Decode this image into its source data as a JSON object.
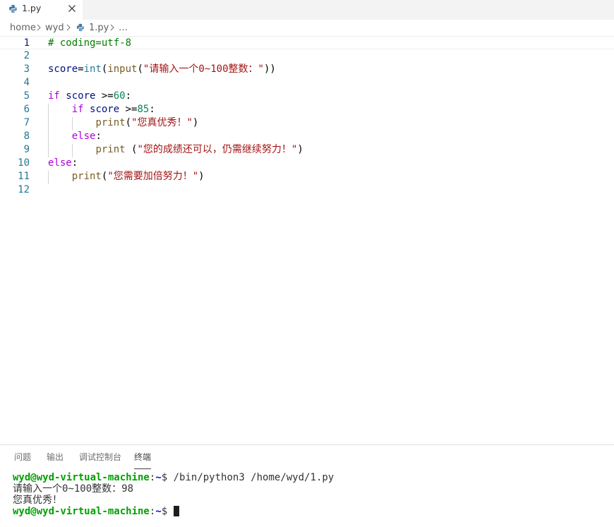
{
  "tab": {
    "label": "1.py"
  },
  "breadcrumb": {
    "items": [
      "home",
      "wyd",
      "1.py",
      "…"
    ]
  },
  "editor": {
    "current_line": 1,
    "lines": [
      {
        "n": "1",
        "tokens": [
          {
            "t": "# coding=utf-8",
            "c": "comment"
          }
        ]
      },
      {
        "n": "2",
        "tokens": []
      },
      {
        "n": "3",
        "tokens": [
          {
            "t": "score",
            "c": "var"
          },
          {
            "t": "=",
            "c": "op"
          },
          {
            "t": "int",
            "c": "type"
          },
          {
            "t": "(",
            "c": "op"
          },
          {
            "t": "input",
            "c": "func"
          },
          {
            "t": "(",
            "c": "op"
          },
          {
            "t": "\"请输入一个0~100整数：\"",
            "c": "str"
          },
          {
            "t": "))",
            "c": "op"
          }
        ]
      },
      {
        "n": "4",
        "tokens": []
      },
      {
        "n": "5",
        "tokens": [
          {
            "t": "if",
            "c": "kw"
          },
          {
            "t": " ",
            "c": "op"
          },
          {
            "t": "score",
            "c": "var"
          },
          {
            "t": " >=",
            "c": "op"
          },
          {
            "t": "60",
            "c": "num"
          },
          {
            "t": ":",
            "c": "op"
          }
        ]
      },
      {
        "n": "6",
        "tokens": [
          {
            "t": "    ",
            "c": "op"
          },
          {
            "t": "if",
            "c": "kw"
          },
          {
            "t": " ",
            "c": "op"
          },
          {
            "t": "score",
            "c": "var"
          },
          {
            "t": " >=",
            "c": "op"
          },
          {
            "t": "85",
            "c": "num"
          },
          {
            "t": ":",
            "c": "op"
          }
        ]
      },
      {
        "n": "7",
        "tokens": [
          {
            "t": "        ",
            "c": "op"
          },
          {
            "t": "print",
            "c": "func"
          },
          {
            "t": "(",
            "c": "op"
          },
          {
            "t": "\"您真优秀！\"",
            "c": "str"
          },
          {
            "t": ")",
            "c": "op"
          }
        ]
      },
      {
        "n": "8",
        "tokens": [
          {
            "t": "    ",
            "c": "op"
          },
          {
            "t": "else",
            "c": "kw"
          },
          {
            "t": ":",
            "c": "op"
          }
        ]
      },
      {
        "n": "9",
        "tokens": [
          {
            "t": "        ",
            "c": "op"
          },
          {
            "t": "print",
            "c": "func"
          },
          {
            "t": " (",
            "c": "op"
          },
          {
            "t": "\"您的成绩还可以，仍需继续努力！\"",
            "c": "str"
          },
          {
            "t": ")",
            "c": "op"
          }
        ]
      },
      {
        "n": "10",
        "tokens": [
          {
            "t": "else",
            "c": "kw"
          },
          {
            "t": ":",
            "c": "op"
          }
        ]
      },
      {
        "n": "11",
        "tokens": [
          {
            "t": "    ",
            "c": "op"
          },
          {
            "t": "print",
            "c": "func"
          },
          {
            "t": "(",
            "c": "op"
          },
          {
            "t": "\"您需要加倍努力！\"",
            "c": "str"
          },
          {
            "t": ")",
            "c": "op"
          }
        ]
      },
      {
        "n": "12",
        "tokens": []
      }
    ]
  },
  "panel": {
    "tabs": [
      "问题",
      "输出",
      "调试控制台",
      "终端"
    ],
    "active_tab": "终端"
  },
  "terminal": {
    "user": "wyd@wyd-virtual-machine",
    "sep": ":",
    "path": "~",
    "prompt_end": "$ ",
    "command": "/bin/python3 /home/wyd/1.py",
    "output": [
      "请输入一个0~100整数：98",
      "您真优秀！"
    ]
  },
  "colors": {
    "comment": "#008000",
    "var": "#001080",
    "type": "#267f99",
    "func": "#795e26",
    "str": "#a31515",
    "num": "#098658",
    "kw": "#af00db",
    "line_number": "#237893",
    "terminal_user": "#00a000",
    "terminal_path": "#0000ff"
  }
}
